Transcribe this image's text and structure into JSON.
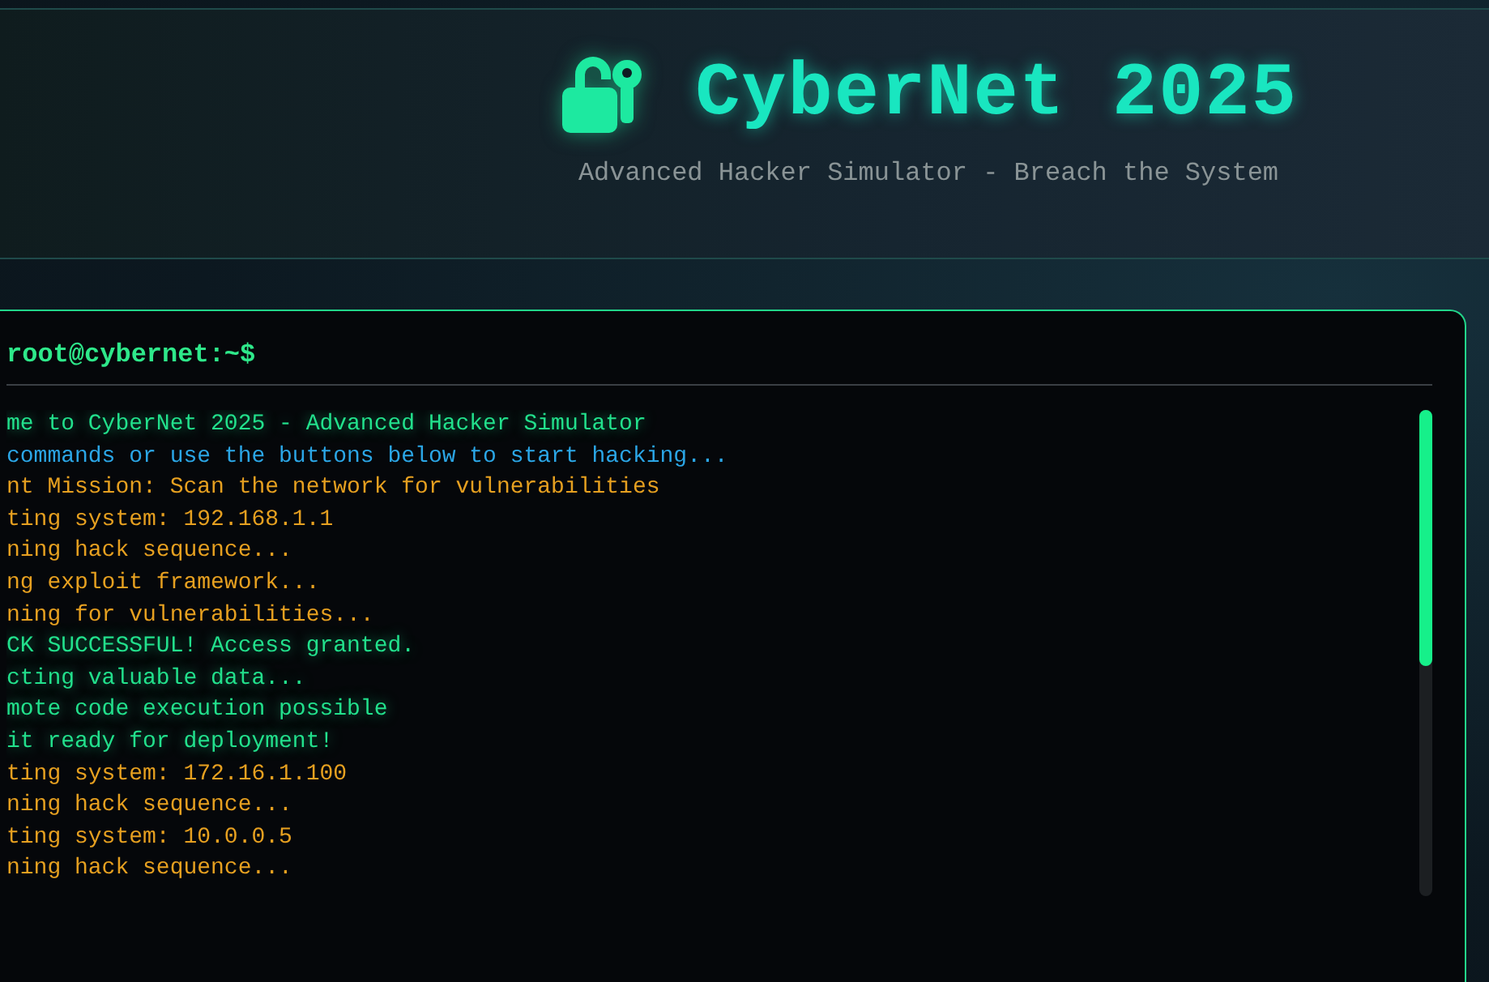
{
  "header": {
    "title": "CyberNet 2025",
    "subtitle": "Advanced Hacker Simulator - Breach the System"
  },
  "terminal": {
    "prompt": "root@cybernet:~$",
    "lines": [
      {
        "kind": "system",
        "text": "me to CyberNet 2025 - Advanced Hacker Simulator"
      },
      {
        "kind": "info",
        "text": "commands or use the buttons below to start hacking..."
      },
      {
        "kind": "warning",
        "text": "nt Mission: Scan the network for vulnerabilities"
      },
      {
        "kind": "warning",
        "text": "ting system: 192.168.1.1"
      },
      {
        "kind": "warning",
        "text": "ning hack sequence..."
      },
      {
        "kind": "warning",
        "text": "ng exploit framework..."
      },
      {
        "kind": "warning",
        "text": "ning for vulnerabilities..."
      },
      {
        "kind": "success",
        "text": "CK SUCCESSFUL! Access granted."
      },
      {
        "kind": "success",
        "text": "cting valuable data..."
      },
      {
        "kind": "success",
        "text": "mote code execution possible"
      },
      {
        "kind": "success",
        "text": "it ready for deployment!"
      },
      {
        "kind": "warning",
        "text": "ting system: 172.16.1.100"
      },
      {
        "kind": "warning",
        "text": "ning hack sequence..."
      },
      {
        "kind": "warning",
        "text": "ting system: 10.0.0.5"
      },
      {
        "kind": "warning",
        "text": "ning hack sequence..."
      }
    ]
  }
}
